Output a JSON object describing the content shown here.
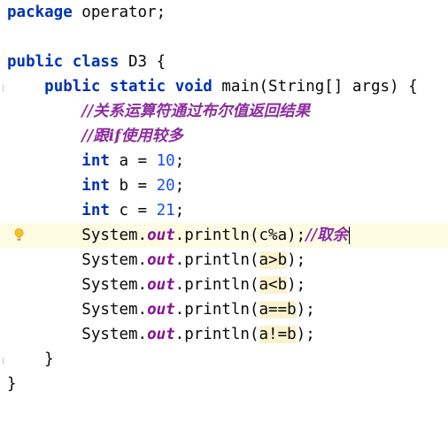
{
  "code": {
    "package_kw": "package",
    "package_name": " operator;",
    "class_public": "public",
    "class_kw": "class",
    "class_name": " D3 {",
    "method_public": "public",
    "method_static": "static",
    "method_void": "void",
    "method_sig": " main(String[] args) {",
    "comment1": "//关系运算符通过布尔值返回结果",
    "comment2": "//跟if使用较多",
    "int_kw": "int",
    "var_a": " a = ",
    "val_a": "10",
    "var_b": " b = ",
    "val_b": "20",
    "var_c": " c = ",
    "val_c": "21",
    "semi": ";",
    "sys": "System.",
    "out": "out",
    "println": ".println(",
    "arg1": "c%a",
    "end1": ");",
    "comment3": "//取余",
    "arg2": "a>b",
    "arg3": "a<b",
    "arg4": "a==b",
    "arg5": "a!=b",
    "end": ");",
    "close_method": "}",
    "close_class": "}"
  },
  "colors": {
    "keyword": "#0033b3",
    "number": "#1750eb",
    "static_field": "#871094",
    "comment": "#8c2ca0",
    "caret_row": "#fefbe3",
    "arg_highlight": "#fbf3cf"
  },
  "icons": {
    "intention": "lightbulb-icon"
  }
}
